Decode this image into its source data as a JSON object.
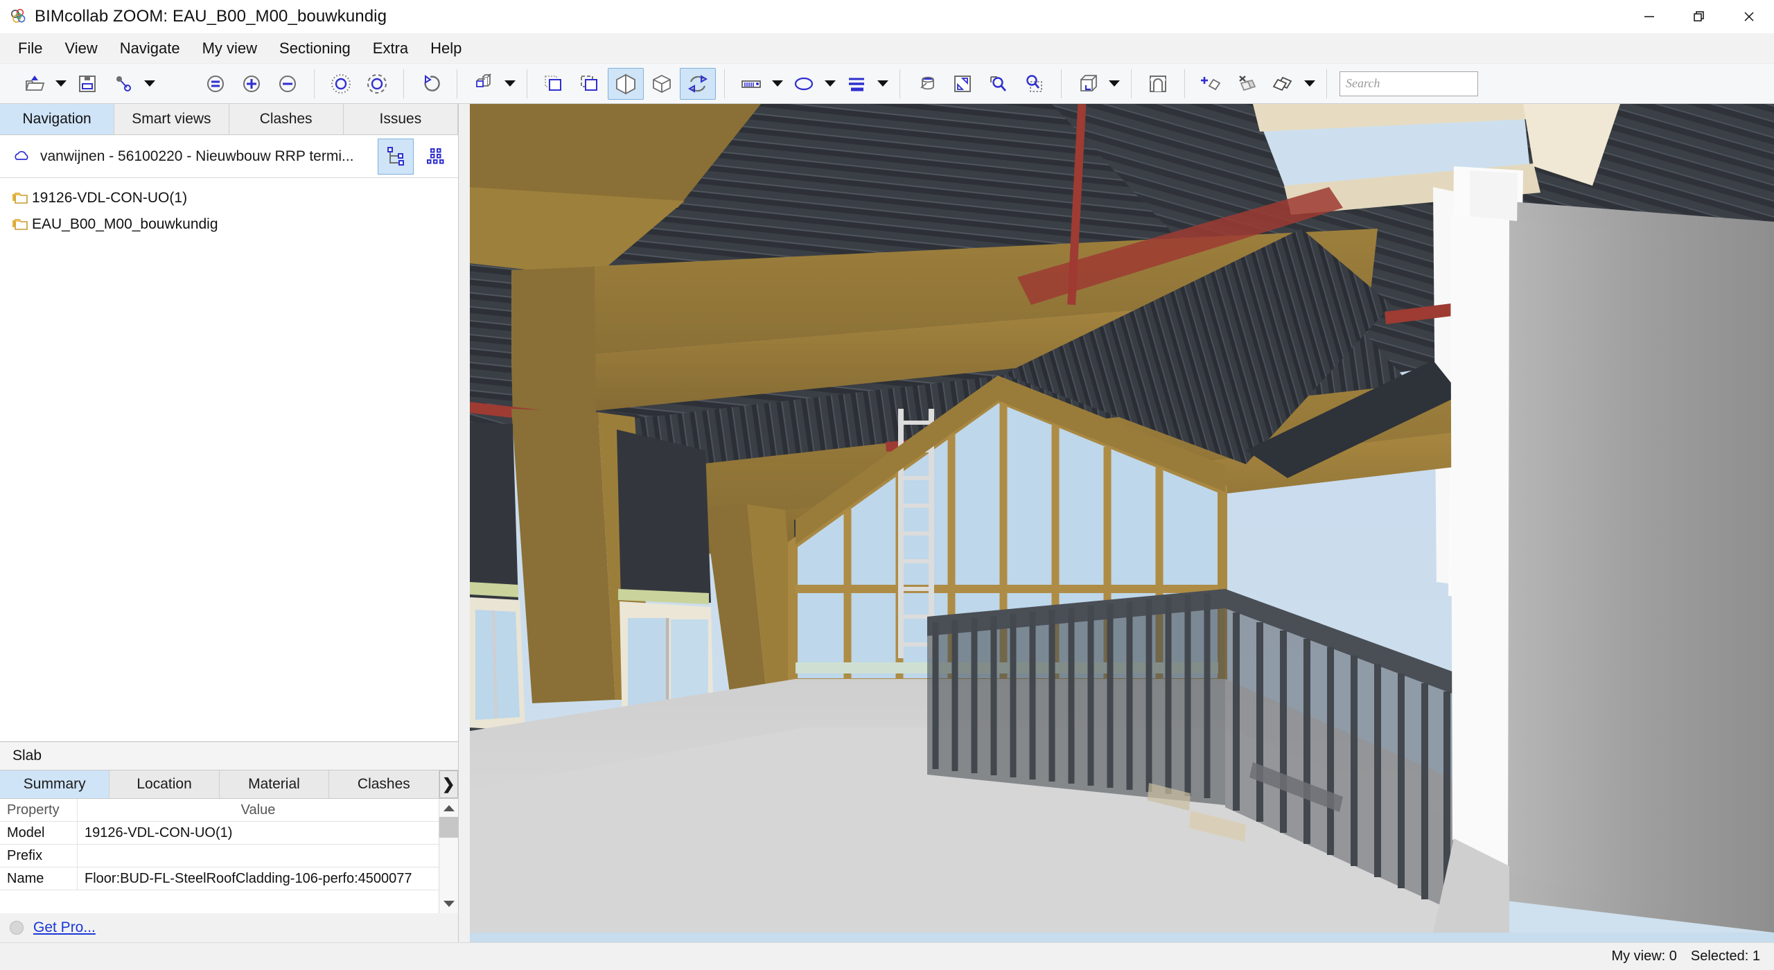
{
  "window": {
    "title": "BIMcollab ZOOM: EAU_B00_M00_bouwkundig",
    "logo_icon": "bimcollab-logo-icon",
    "minimize_icon": "minimize-icon",
    "restore_icon": "restore-icon",
    "close_icon": "close-icon"
  },
  "menubar": {
    "items": [
      {
        "label": "File"
      },
      {
        "label": "View"
      },
      {
        "label": "Navigate"
      },
      {
        "label": "My view"
      },
      {
        "label": "Sectioning"
      },
      {
        "label": "Extra"
      },
      {
        "label": "Help"
      }
    ]
  },
  "toolbar": {
    "groups": [
      {
        "buttons": [
          {
            "name": "open-project-button",
            "icon": "open-folder-icon",
            "caret": true,
            "active": false
          },
          {
            "name": "save-button",
            "icon": "floppy-save-icon",
            "caret": false,
            "active": false
          },
          {
            "name": "link-models-button",
            "icon": "link-node-icon",
            "caret": true,
            "active": false
          }
        ]
      },
      {
        "buttons": [
          {
            "name": "zoom-fit-button",
            "icon": "zoom-equal-icon",
            "caret": false,
            "active": false
          },
          {
            "name": "zoom-in-button",
            "icon": "zoom-plus-icon",
            "caret": false,
            "active": false
          },
          {
            "name": "zoom-out-button",
            "icon": "zoom-minus-icon",
            "caret": false,
            "active": false
          }
        ]
      },
      {
        "buttons": [
          {
            "name": "orbit-point-button",
            "icon": "orbit-dotted-icon",
            "caret": false,
            "active": false
          },
          {
            "name": "orbit-center-button",
            "icon": "orbit-dashed-icon",
            "caret": false,
            "active": false
          }
        ]
      },
      {
        "buttons": [
          {
            "name": "undo-view-button",
            "icon": "undo-arrow-icon",
            "caret": false,
            "active": false
          }
        ]
      },
      {
        "buttons": [
          {
            "name": "model-visibility-button",
            "icon": "two-boxes-icon",
            "caret": true,
            "active": false
          }
        ]
      },
      {
        "buttons": [
          {
            "name": "select-rectangle-button",
            "icon": "dotted-select-icon",
            "caret": false,
            "active": false
          },
          {
            "name": "select-window-button",
            "icon": "dashed-select-icon",
            "caret": false,
            "active": false
          },
          {
            "name": "section-box-button",
            "icon": "split-cube-icon",
            "caret": false,
            "active": true
          },
          {
            "name": "solid-cube-button",
            "icon": "cube-icon",
            "caret": false,
            "active": false
          },
          {
            "name": "turntable-button",
            "icon": "rotate-arrows-icon",
            "caret": false,
            "active": true
          }
        ]
      },
      {
        "buttons": [
          {
            "name": "measure-button",
            "icon": "ruler-icon",
            "caret": true,
            "active": false
          },
          {
            "name": "ellipse-markup-button",
            "icon": "ellipse-icon",
            "caret": true,
            "active": false
          },
          {
            "name": "line-weight-button",
            "icon": "lines-icon",
            "caret": true,
            "active": false
          }
        ]
      },
      {
        "buttons": [
          {
            "name": "paint-color-button",
            "icon": "paint-bucket-icon",
            "caret": false,
            "active": false
          },
          {
            "name": "resize-view-button",
            "icon": "resize-diagonal-icon",
            "caret": false,
            "active": false
          },
          {
            "name": "zoom-selected-button",
            "icon": "zoom-object-icon",
            "caret": false,
            "active": false
          },
          {
            "name": "zoom-area-button",
            "icon": "zoom-area-icon",
            "caret": false,
            "active": false
          }
        ]
      },
      {
        "buttons": [
          {
            "name": "projection-button",
            "icon": "projection-cube-icon",
            "caret": true,
            "active": false
          }
        ]
      },
      {
        "buttons": [
          {
            "name": "clipping-plane-button",
            "icon": "clip-plane-icon",
            "caret": false,
            "active": false
          }
        ]
      },
      {
        "buttons": [
          {
            "name": "add-view-button",
            "icon": "add-slab-icon",
            "caret": false,
            "active": false
          },
          {
            "name": "hide-slab-button",
            "icon": "hide-slab-icon",
            "caret": false,
            "active": false
          },
          {
            "name": "slabs-button",
            "icon": "slabs-icon",
            "caret": true,
            "active": false
          }
        ]
      }
    ],
    "search": {
      "placeholder": "Search",
      "value": ""
    }
  },
  "left_panel": {
    "tabs": [
      {
        "label": "Navigation",
        "selected": true
      },
      {
        "label": "Smart views",
        "selected": false
      },
      {
        "label": "Clashes",
        "selected": false
      },
      {
        "label": "Issues",
        "selected": false
      }
    ],
    "project": {
      "cloud_icon": "cloud-icon",
      "name": "vanwijnen - 56100220 - Nieuwbouw RRP termi...",
      "tree_view_icon": "tree-view-icon",
      "grid_view_icon": "grid-view-icon"
    },
    "tree_items": [
      {
        "icon": "folder-model-icon",
        "label": "19126-VDL-CON-UO(1)"
      },
      {
        "icon": "folder-model-icon",
        "label": "EAU_B00_M00_bouwkundig"
      }
    ]
  },
  "property_panel": {
    "title": "Slab",
    "tabs": [
      {
        "label": "Summary",
        "selected": true
      },
      {
        "label": "Location",
        "selected": false
      },
      {
        "label": "Material",
        "selected": false
      },
      {
        "label": "Clashes",
        "selected": false
      }
    ],
    "more_tabs_icon": "chevron-right-icon",
    "columns": [
      "Property",
      "Value"
    ],
    "rows": [
      {
        "property": "Model",
        "value": "19126-VDL-CON-UO(1)"
      },
      {
        "property": "Prefix",
        "value": ""
      },
      {
        "property": "Name",
        "value": "Floor:BUD-FL-SteelRoofCladding-106-perfo:4500077"
      }
    ],
    "scroll_up_icon": "scroll-up-icon",
    "scroll_down_icon": "scroll-down-icon"
  },
  "bottom_left": {
    "status_icon": "status-dot-icon",
    "get_pro_label": "Get Pro..."
  },
  "statusbar": {
    "my_view_label": "My view: 0",
    "selected_label": "Selected: 1"
  },
  "viewport": {
    "name": "3d-model-viewport",
    "description": "Interior 3D BIM view of a steel-framed hall with timber-coloured portal frames, dark corrugated steel roof deck, clerestory glazing and a dark balustrade around a floor opening",
    "colors": {
      "sky": "#c9dced",
      "timber_beam": "#8a6d36",
      "timber_beam_light": "#a58448",
      "roof_deck": "#3b3f45",
      "roof_deck_dark": "#2e3238",
      "glass": "#bcd6ea",
      "floor": "#d4d4d4",
      "wall_white": "#f7f7f7",
      "wall_grey": "#9a9a9a",
      "railing": "#42454b",
      "red_pipe": "#9e3b33",
      "ladder": "#d8d8d8",
      "mullion": "#b08a43"
    }
  }
}
